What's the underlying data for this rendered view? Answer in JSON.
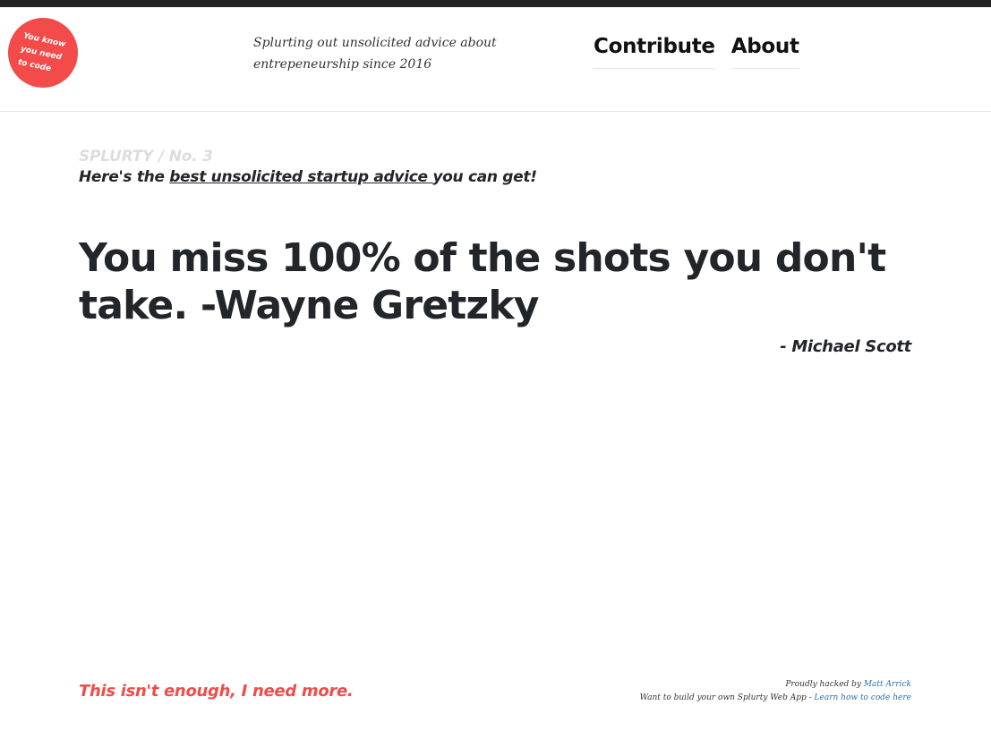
{
  "header": {
    "badge_text": "You know you need to code",
    "tagline": "Splurting out unsolicited advice about entrepeneurship since 2016",
    "nav": {
      "contribute": "Contribute",
      "about": "About"
    }
  },
  "main": {
    "kicker": "SPLURTY / No. 3",
    "subhead_prefix": "Here's the ",
    "subhead_link": "best unsolicited startup advice ",
    "subhead_suffix": "you can get!",
    "quote": "You miss 100% of the shots you don't take. -Wayne Gretzky",
    "attribution": "- Michael Scott"
  },
  "footer": {
    "more_link": "This isn't enough, I need more.",
    "credit_prefix": "Proudly hacked by ",
    "credit_author": "Matt Arrick",
    "build_prefix": "Want to build your own Splurty Web App - ",
    "build_link": "Learn how to code here"
  },
  "colors": {
    "accent": "#f34a4a",
    "text": "#222529",
    "muted": "#dddddd",
    "link": "#2a6fb0",
    "top_bar": "#232323"
  }
}
